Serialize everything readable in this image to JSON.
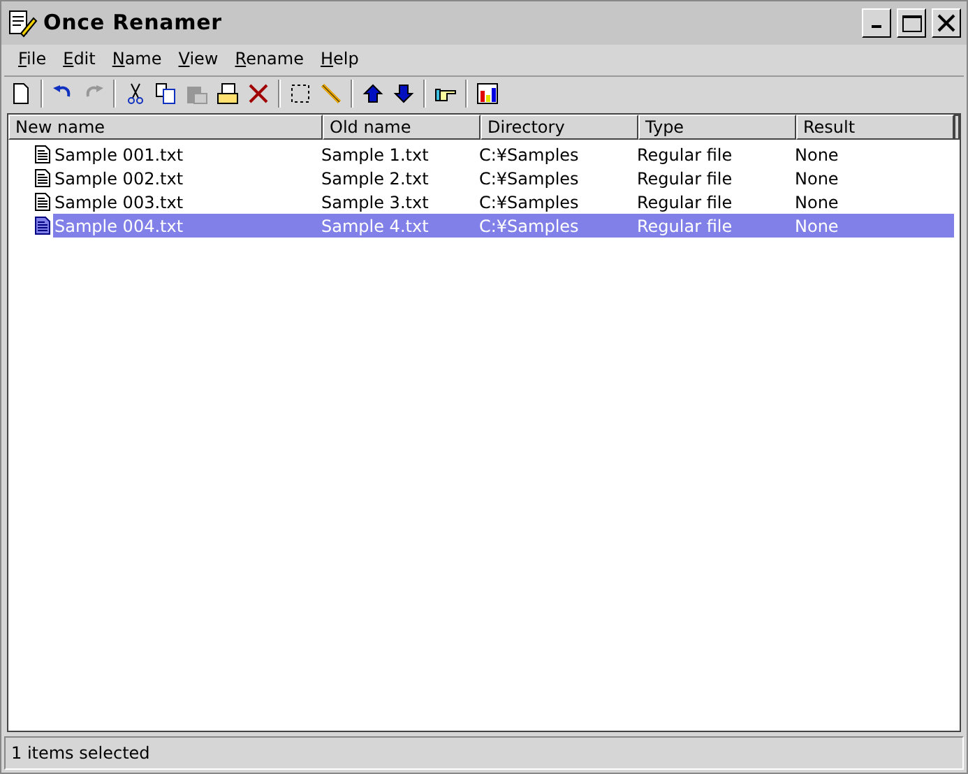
{
  "window": {
    "title": "Once Renamer"
  },
  "menu": [
    "File",
    "Edit",
    "Name",
    "View",
    "Rename",
    "Help"
  ],
  "toolbar": [
    {
      "kind": "new",
      "disabled": false
    },
    {
      "kind": "sep"
    },
    {
      "kind": "undo",
      "disabled": false
    },
    {
      "kind": "redo",
      "disabled": true
    },
    {
      "kind": "sep"
    },
    {
      "kind": "cut",
      "disabled": false
    },
    {
      "kind": "copy",
      "disabled": false
    },
    {
      "kind": "paste",
      "disabled": true
    },
    {
      "kind": "open",
      "disabled": false
    },
    {
      "kind": "delete",
      "disabled": false
    },
    {
      "kind": "sep"
    },
    {
      "kind": "select",
      "disabled": false
    },
    {
      "kind": "pencil",
      "disabled": false
    },
    {
      "kind": "sep"
    },
    {
      "kind": "up",
      "disabled": false
    },
    {
      "kind": "down",
      "disabled": false
    },
    {
      "kind": "sep"
    },
    {
      "kind": "hand",
      "disabled": false
    },
    {
      "kind": "sep"
    },
    {
      "kind": "chart",
      "disabled": false
    }
  ],
  "table": {
    "columns": [
      "New name",
      "Old name",
      "Directory",
      "Type",
      "Result"
    ],
    "rows": [
      {
        "cells": [
          "Sample 001.txt",
          "Sample 1.txt",
          "C:¥Samples",
          "Regular file",
          "None"
        ],
        "selected": false
      },
      {
        "cells": [
          "Sample 002.txt",
          "Sample 2.txt",
          "C:¥Samples",
          "Regular file",
          "None"
        ],
        "selected": false
      },
      {
        "cells": [
          "Sample 003.txt",
          "Sample 3.txt",
          "C:¥Samples",
          "Regular file",
          "None"
        ],
        "selected": false
      },
      {
        "cells": [
          "Sample 004.txt",
          "Sample 4.txt",
          "C:¥Samples",
          "Regular file",
          "None"
        ],
        "selected": true
      }
    ]
  },
  "status_bar": "1 items selected"
}
